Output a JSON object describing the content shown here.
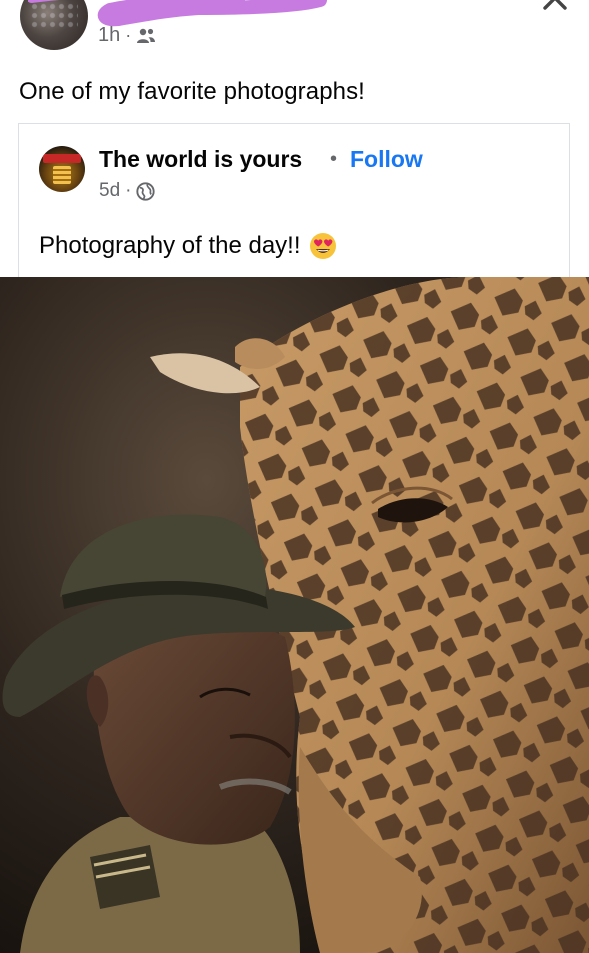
{
  "header": {
    "timestamp": "1h",
    "separator": "·",
    "audience_icon": "friends-icon",
    "more_icon": "more-horizontal-icon",
    "close_icon": "close-icon"
  },
  "post": {
    "text": "One of my favorite photographs!"
  },
  "shared_post": {
    "page_name": "The world is yours",
    "dot": "•",
    "follow_label": "Follow",
    "timestamp": "5d",
    "separator": "·",
    "audience_icon": "globe-icon",
    "text": "Photography of the day!!",
    "emoji": "heart-eyes-emoji-icon"
  },
  "colors": {
    "link_blue": "#1877f2",
    "meta_gray": "#65676b",
    "redaction_purple": "#c77be0"
  }
}
